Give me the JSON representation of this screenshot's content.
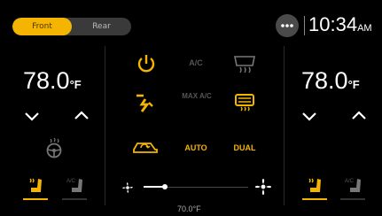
{
  "tabs": {
    "front": "Front",
    "rear": "Rear",
    "active": "Front"
  },
  "header": {
    "time": "10:34",
    "ampm": "AM"
  },
  "left_zone": {
    "temp": "78.0",
    "unit": "°F"
  },
  "right_zone": {
    "temp": "78.0",
    "unit": "°F"
  },
  "controls": {
    "ac_label": "A/C",
    "max_ac_label": "MAX A/C",
    "auto_label": "AUTO",
    "dual_label": "DUAL"
  },
  "fan": {
    "level": 0.2
  },
  "bottom_temp": "70.0°F",
  "colors": {
    "accent": "#f4b400",
    "dim": "#555555",
    "background": "#000000"
  }
}
